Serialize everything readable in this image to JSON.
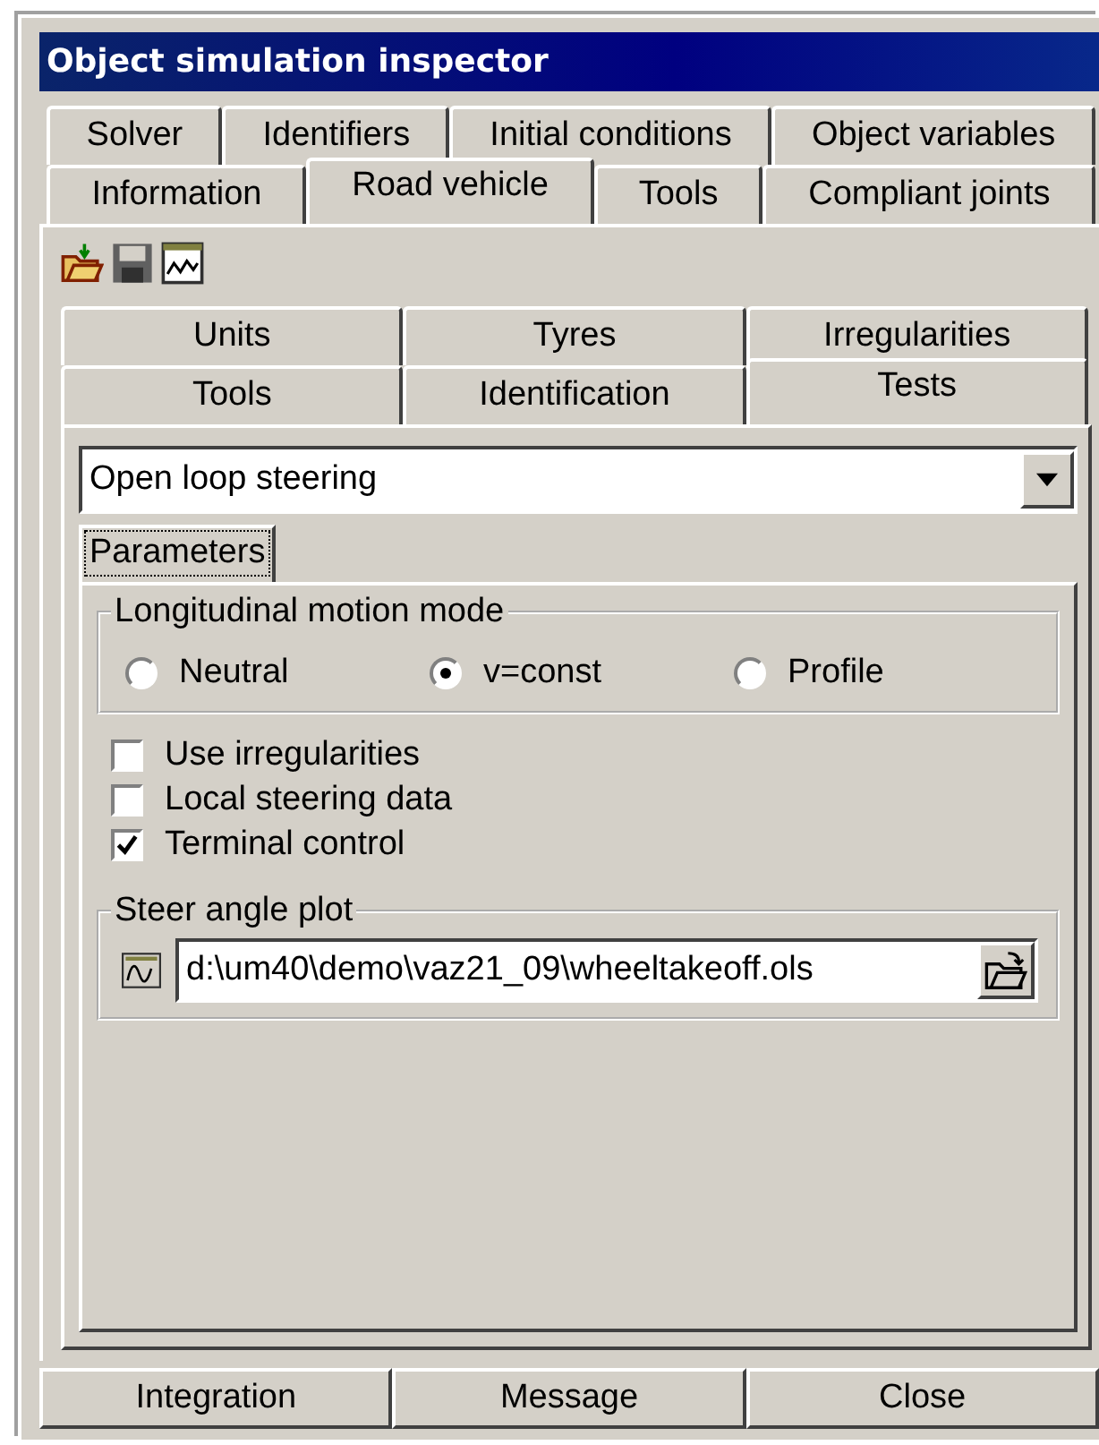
{
  "window": {
    "title": "Object simulation inspector"
  },
  "tab_rows": [
    {
      "tabs": [
        {
          "label": "Solver",
          "selected": false
        },
        {
          "label": "Identifiers",
          "selected": false
        },
        {
          "label": "Initial conditions",
          "selected": false
        },
        {
          "label": "Object variables",
          "selected": false
        }
      ]
    },
    {
      "tabs": [
        {
          "label": "Information",
          "selected": false
        },
        {
          "label": "Road vehicle",
          "selected": true
        },
        {
          "label": "Tools",
          "selected": false
        },
        {
          "label": "Compliant joints",
          "selected": false
        }
      ]
    }
  ],
  "sub_tab_rows": [
    {
      "tabs": [
        {
          "label": "Units",
          "selected": false
        },
        {
          "label": "Tyres",
          "selected": false
        },
        {
          "label": "Irregularities",
          "selected": false
        }
      ]
    },
    {
      "tabs": [
        {
          "label": "Tools",
          "selected": false
        },
        {
          "label": "Identification",
          "selected": false
        },
        {
          "label": "Tests",
          "selected": true
        }
      ]
    }
  ],
  "test_select": {
    "value": "Open loop steering"
  },
  "inner_tabs": [
    {
      "label": "Parameters",
      "selected": true
    }
  ],
  "motion_mode": {
    "title": "Longitudinal motion mode",
    "options": [
      {
        "label": "Neutral",
        "selected": false
      },
      {
        "label": "v=const",
        "selected": true
      },
      {
        "label": "Profile",
        "selected": false
      }
    ]
  },
  "options": [
    {
      "label": "Use irregularities",
      "checked": false
    },
    {
      "label": "Local steering data",
      "checked": false
    },
    {
      "label": "Terminal control",
      "checked": true
    }
  ],
  "steer_plot": {
    "title": "Steer angle plot",
    "value": "d:\\um40\\demo\\vaz21_09\\wheeltakeoff.ols"
  },
  "buttons": [
    "Integration",
    "Message",
    "Close"
  ]
}
